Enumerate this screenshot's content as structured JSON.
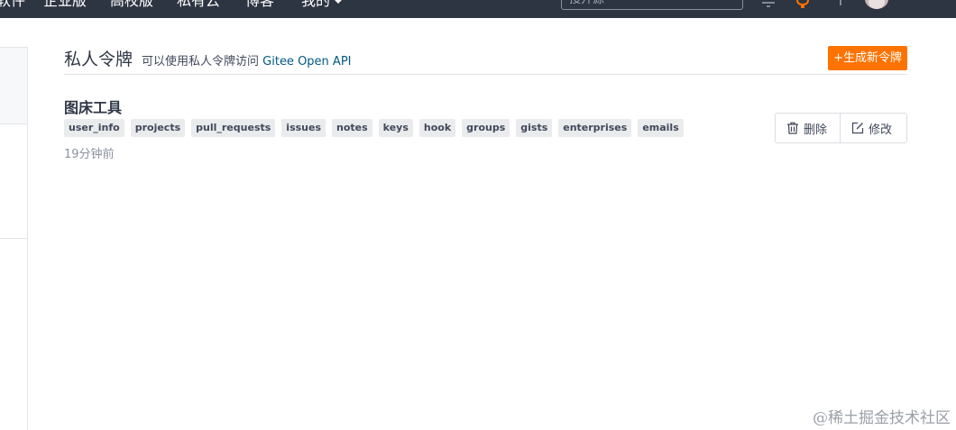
{
  "topnav": {
    "links": [
      "软件",
      "企业版",
      "高校版",
      "私有云",
      "博客",
      "我的"
    ],
    "search_placeholder": "搜开源"
  },
  "header": {
    "title": "私人令牌",
    "description_prefix": "可以使用私人令牌访问",
    "description_link": "Gitee Open API",
    "generate_button": "+生成新令牌"
  },
  "token": {
    "name": "图床工具",
    "scopes": [
      "user_info",
      "projects",
      "pull_requests",
      "issues",
      "notes",
      "keys",
      "hook",
      "groups",
      "gists",
      "enterprises",
      "emails"
    ],
    "time": "19分钟前",
    "delete_label": "删除",
    "edit_label": "修改"
  },
  "watermark": "@稀土掘金技术社区",
  "colors": {
    "nav_bg": "#2d3442",
    "accent": "#fe7300",
    "link": "#005980",
    "tag_bg": "#eaebec"
  }
}
